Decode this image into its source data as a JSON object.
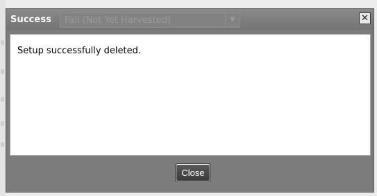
{
  "dialog": {
    "title": "Success",
    "background_select_text": "Fall (Not Yet Harvested)",
    "close_icon_glyph": "✕",
    "message": "Setup successfully deleted.",
    "close_button_label": "Close"
  },
  "icons": {
    "close": "close-icon",
    "dropdown": "chevron-down-icon"
  },
  "colors": {
    "titlebar": "#7c7c7c",
    "content_bg": "#ffffff",
    "button_bg": "#3a3a3a",
    "button_text": "#ffffff"
  }
}
